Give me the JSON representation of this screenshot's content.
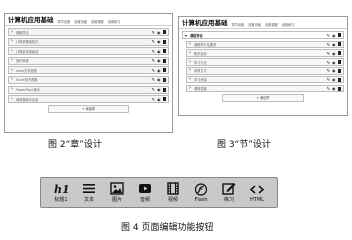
{
  "fig_a": {
    "app_title": "计算机应用基础",
    "tabs": [
      "章节设置",
      "设置页面",
      "设置课程",
      "设置练习"
    ],
    "rows": [
      {
        "label": "课程导论"
      },
      {
        "label": "计算机基础知识"
      },
      {
        "label": "计算机系统组成"
      },
      {
        "label": "操作系统"
      },
      {
        "label": "word文字处理"
      },
      {
        "label": "Excel电子表格"
      },
      {
        "label": "PowerPoint演示"
      },
      {
        "label": "网络基础与应用"
      }
    ],
    "add_label": "+ 添加章",
    "caption": "图 2“章”设计"
  },
  "fig_b": {
    "app_title": "计算机应用基础",
    "tabs": [
      "章节设置",
      "设置页面",
      "设置课程",
      "设置练习"
    ],
    "chapter": "课程导论",
    "sections": [
      {
        "label": "课程简介及要求"
      },
      {
        "label": "教学目标"
      },
      {
        "label": "学习方法"
      },
      {
        "label": "考核方式"
      },
      {
        "label": "学习资源"
      },
      {
        "label": "课程答疑"
      }
    ],
    "add_label": "+ 添加节",
    "caption": "图 3“节”设计"
  },
  "toolbar": {
    "buttons": [
      {
        "label": "标题1",
        "icon": "heading-icon"
      },
      {
        "label": "文本",
        "icon": "text-icon"
      },
      {
        "label": "图片",
        "icon": "image-icon"
      },
      {
        "label": "音频",
        "icon": "audio-icon"
      },
      {
        "label": "视频",
        "icon": "video-icon"
      },
      {
        "label": "Flash",
        "icon": "flash-icon"
      },
      {
        "label": "练习",
        "icon": "exercise-icon"
      },
      {
        "label": "HTML",
        "icon": "html-icon"
      }
    ],
    "caption": "图 4 页面编辑功能按钮"
  }
}
